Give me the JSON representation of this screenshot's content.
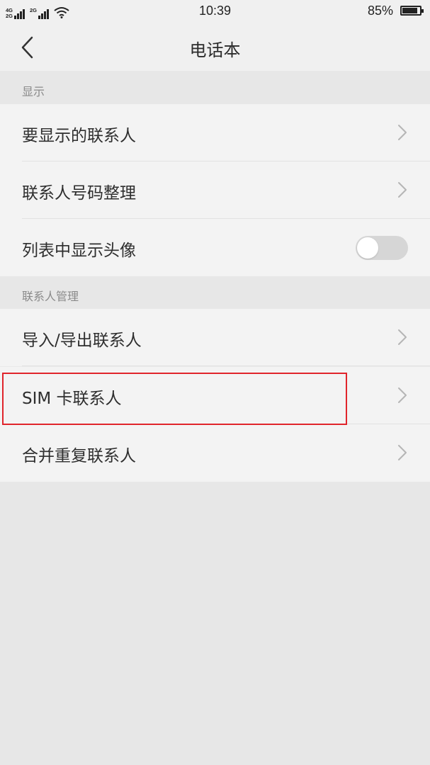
{
  "status_bar": {
    "network_top": "4G",
    "network_bottom": "2G",
    "network2": "2G",
    "time": "10:39",
    "battery": "85%",
    "wifi_icon": "wifi-icon",
    "battery_icon": "battery-icon"
  },
  "header": {
    "title": "电话本",
    "back_icon": "chevron-left-icon"
  },
  "sections": {
    "display": {
      "label": "显示",
      "items": [
        {
          "label": "要显示的联系人",
          "control": "chevron"
        },
        {
          "label": "联系人号码整理",
          "control": "chevron"
        },
        {
          "label": "列表中显示头像",
          "control": "toggle",
          "toggle_on": false
        }
      ]
    },
    "manage": {
      "label": "联系人管理",
      "items": [
        {
          "label": "导入/导出联系人",
          "control": "chevron"
        },
        {
          "label": "SIM 卡联系人",
          "control": "chevron",
          "highlighted": true
        },
        {
          "label": "合并重复联系人",
          "control": "chevron"
        }
      ]
    }
  },
  "colors": {
    "highlight": "#e0242b",
    "background": "#e9e9e9",
    "row_background": "#f3f3f3"
  }
}
